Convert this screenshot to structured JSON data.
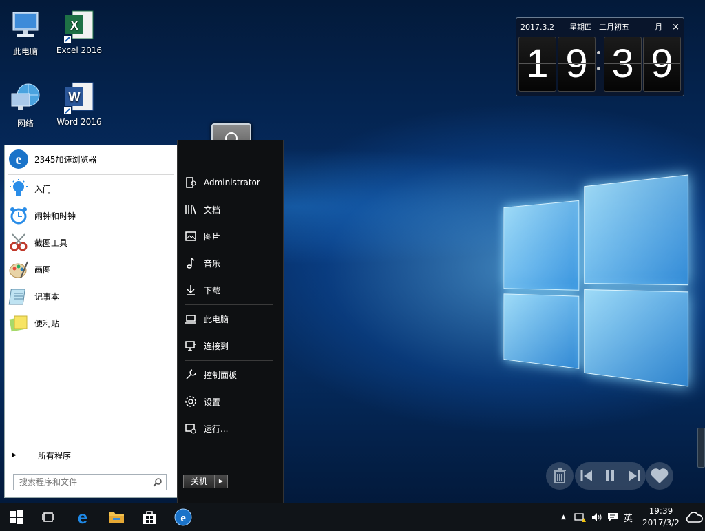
{
  "desktop": {
    "icons": [
      {
        "label": "此电脑"
      },
      {
        "label": "Excel 2016"
      },
      {
        "label": "网络"
      },
      {
        "label": "Word 2016"
      }
    ]
  },
  "clock_widget": {
    "date": "2017.3.2",
    "weekday": "星期四",
    "lunar": "二月初五",
    "mode": "月",
    "close": "×",
    "digits": [
      "1",
      "9",
      "3",
      "9"
    ]
  },
  "start_menu": {
    "pinned": {
      "label": "2345加速浏览器"
    },
    "items": [
      {
        "label": "入门"
      },
      {
        "label": "闹钟和时钟"
      },
      {
        "label": "截图工具"
      },
      {
        "label": "画图"
      },
      {
        "label": "记事本"
      },
      {
        "label": "便利贴"
      }
    ],
    "all_programs": "所有程序",
    "search_placeholder": "搜索程序和文件",
    "right": {
      "user": "Administrator",
      "items": [
        "文档",
        "图片",
        "音乐",
        "下载",
        "此电脑",
        "连接到",
        "控制面板",
        "设置",
        "运行..."
      ]
    },
    "shutdown": "关机"
  },
  "taskbar": {
    "ime": "英",
    "time": "19:39",
    "date": "2017/3/2"
  },
  "colors": {
    "accent": "#1e7fd8",
    "taskbar_bg": "#101418",
    "menu_right_bg": "#0e1012"
  }
}
